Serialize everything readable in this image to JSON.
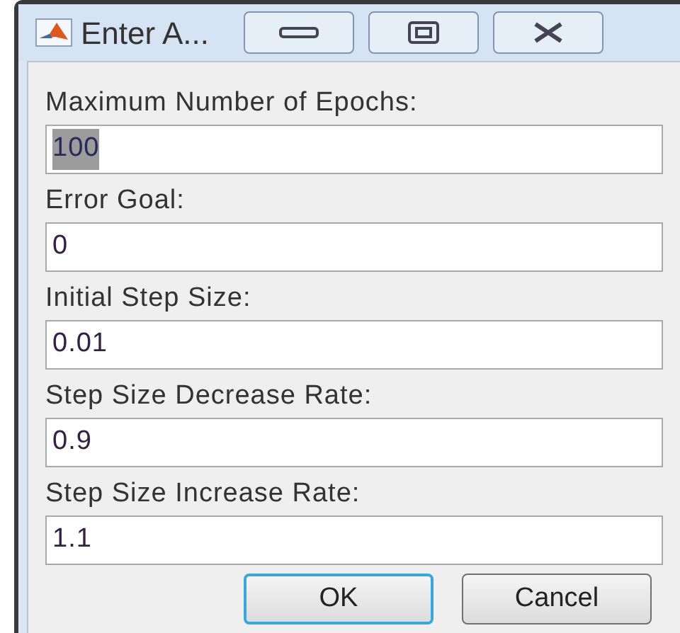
{
  "window": {
    "title": "Enter A..."
  },
  "fields": [
    {
      "label": "Maximum Number of Epochs:",
      "value": "100",
      "selected": true
    },
    {
      "label": "Error Goal:",
      "value": "0",
      "selected": false
    },
    {
      "label": "Initial Step Size:",
      "value": "0.01",
      "selected": false
    },
    {
      "label": "Step Size Decrease Rate:",
      "value": "0.9",
      "selected": false
    },
    {
      "label": "Step Size Increase Rate:",
      "value": "1.1",
      "selected": false
    }
  ],
  "buttons": [
    {
      "label": "OK",
      "default": true
    },
    {
      "label": "Cancel",
      "default": false
    }
  ]
}
